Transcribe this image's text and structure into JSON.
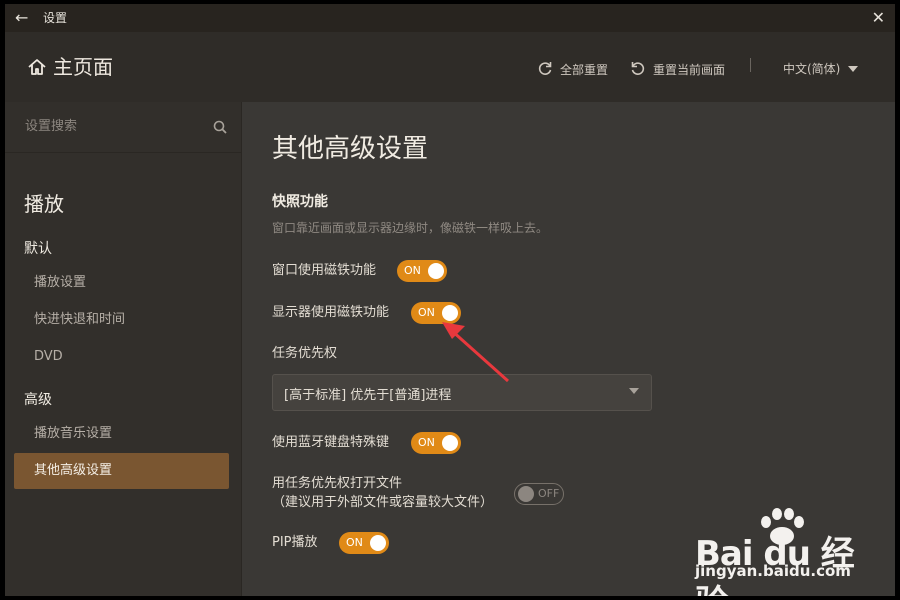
{
  "titlebar": {
    "title": "设置"
  },
  "header": {
    "home_title": "主页面",
    "reset_all": "全部重置",
    "reset_current": "重置当前画面",
    "language": "中文(简体)"
  },
  "sidebar": {
    "search_placeholder": "设置搜索",
    "group_title": "播放",
    "sections": [
      {
        "title": "默认",
        "items": [
          "播放设置",
          "快进快退和时间",
          "DVD"
        ]
      },
      {
        "title": "高级",
        "items": [
          "播放音乐设置",
          "其他高级设置"
        ]
      }
    ],
    "active_item": "其他高级设置"
  },
  "main": {
    "title": "其他高级设置",
    "section_title": "快照功能",
    "section_desc": "窗口靠近画面或显示器边缘时，像磁铁一样吸上去。",
    "rows": [
      {
        "label": "窗口使用磁铁功能",
        "state": "ON"
      },
      {
        "label": "显示器使用磁铁功能",
        "state": "ON"
      }
    ],
    "priority_label": "任务优先权",
    "priority_value": "[高于标准] 优先于[普通]进程",
    "bluetooth_label": "使用蓝牙键盘特殊键",
    "bluetooth_state": "ON",
    "open_priority_label_1": "用任务优先权打开文件",
    "open_priority_label_2": "（建议用于外部文件或容量较大文件）",
    "open_priority_state": "OFF",
    "pip_label": "PIP播放",
    "pip_state": "ON"
  },
  "watermark": {
    "brand": "Bai du 经验",
    "url": "jingyan.baidu.com"
  },
  "colors": {
    "accent": "#e08a17",
    "active_nav": "#7a5631",
    "background": "#3a3835",
    "annotation": "#e8383d"
  }
}
